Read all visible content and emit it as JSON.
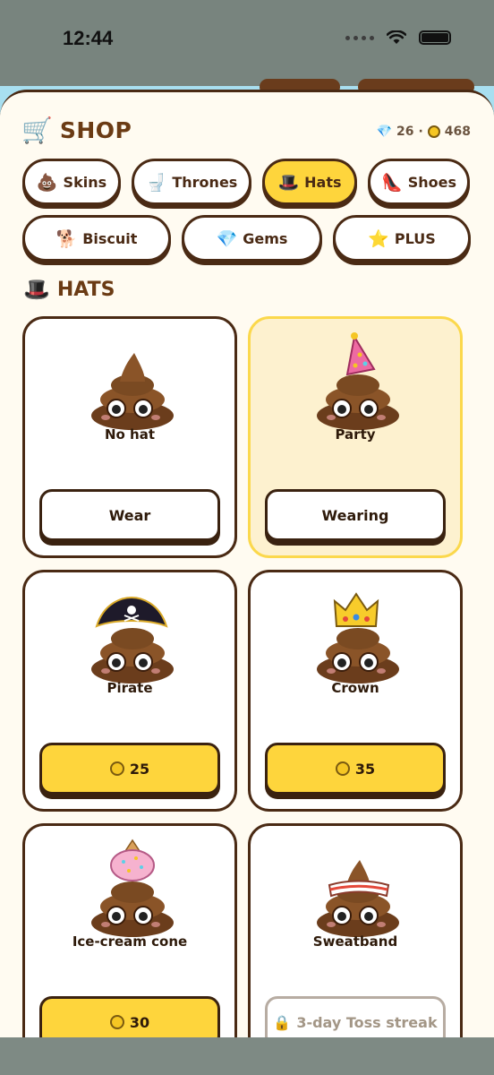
{
  "status": {
    "time": "12:44"
  },
  "header": {
    "icon": "🛒",
    "title": "SHOP",
    "gems": "26",
    "separator": "·",
    "coins": "468",
    "gem_icon": "💎"
  },
  "tabs": [
    {
      "emoji": "💩",
      "label": "Skins",
      "active": false
    },
    {
      "emoji": "🚽",
      "label": "Thrones",
      "active": false
    },
    {
      "emoji": "🎩",
      "label": "Hats",
      "active": true
    },
    {
      "emoji": "👠",
      "label": "Shoes",
      "active": false
    },
    {
      "emoji": "🐕",
      "label": "Biscuit",
      "active": false
    },
    {
      "emoji": "💎",
      "label": "Gems",
      "active": false
    },
    {
      "emoji": "⭐",
      "label": "PLUS",
      "active": false
    }
  ],
  "section": {
    "icon": "🎩",
    "title": "HATS"
  },
  "items": [
    {
      "name": "No hat",
      "hat": "none",
      "button": "Wear",
      "state": "owned"
    },
    {
      "name": "Party",
      "hat": "party-hat",
      "button": "Wearing",
      "state": "equipped"
    },
    {
      "name": "Pirate",
      "hat": "pirate-hat",
      "button": "25",
      "state": "buy"
    },
    {
      "name": "Crown",
      "hat": "crown",
      "button": "35",
      "state": "buy"
    },
    {
      "name": "Ice-cream cone",
      "hat": "ice-cream-cone",
      "button": "30",
      "state": "buy"
    },
    {
      "name": "Sweatband",
      "hat": "sweatband",
      "button": "3-day Toss streak",
      "state": "locked",
      "lock_icon": "🔒"
    }
  ],
  "colors": {
    "accent": "#fed53c",
    "outline": "#4a2a14",
    "sheet": "#fffbf1",
    "selected": "#fdf1cf",
    "poo": "#7a4a22"
  }
}
